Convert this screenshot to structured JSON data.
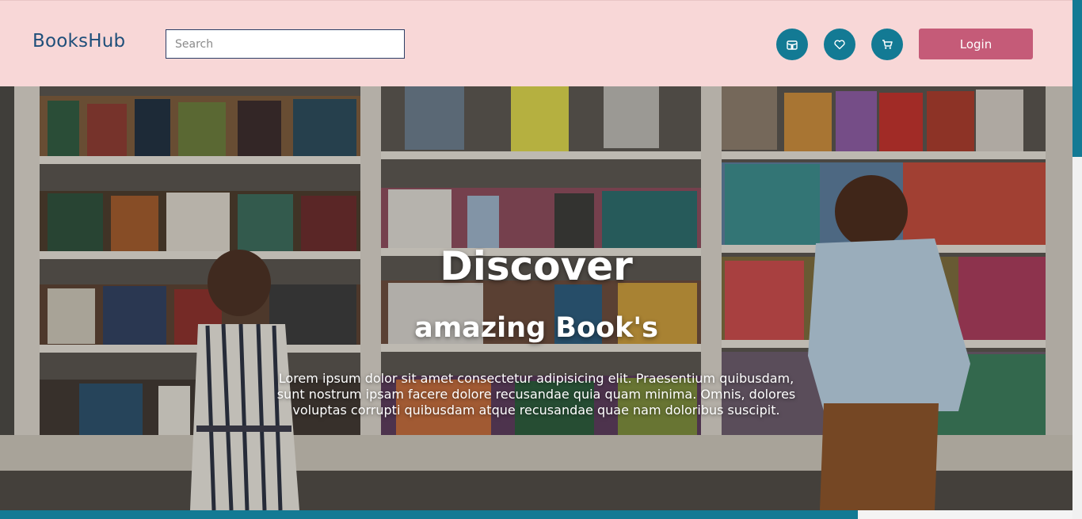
{
  "header": {
    "brand": "BooksHub",
    "search_placeholder": "Search",
    "icons": [
      "store-icon",
      "heart-icon",
      "cart-icon"
    ],
    "login_label": "Login"
  },
  "hero": {
    "title": "Discover",
    "subtitle": "amazing Book's",
    "text": "Lorem ipsum dolor sit amet consectetur adipisicing elit. Praesentium quibusdam, sunt nostrum ipsam facere dolore recusandae quia quam minima. Omnis, dolores voluptas corrupti quibusdam atque recusandae quae nam doloribus suscipit."
  },
  "colors": {
    "header_bg": "#f8d7d7",
    "brand": "#1f4f7a",
    "accent_teal": "#137a94",
    "login_bg": "#c55b78"
  }
}
